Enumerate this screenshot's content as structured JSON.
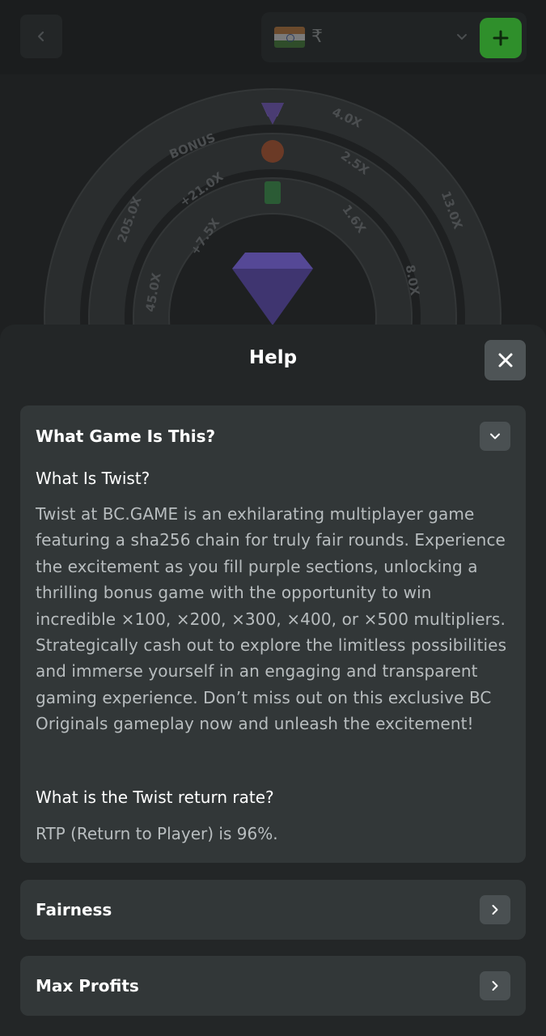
{
  "header": {
    "currency_symbol": "₹"
  },
  "game": {
    "multipliers": [
      "BONUS",
      "4.0X",
      "+21.0X",
      "2.5X",
      "+7.5X",
      "1.6X",
      "205.0X",
      "13.0X",
      "45.0X",
      "8.0X"
    ]
  },
  "help": {
    "title": "Help",
    "sections": [
      {
        "heading": "What Game Is This?",
        "question1": "What Is Twist?",
        "description": "Twist at BC.GAME is an exhilarating multiplayer game featuring a sha256 chain for truly fair rounds. Experience the excitement as you fill purple sections, unlocking a thrilling bonus game with the opportunity to win incredible ×100, ×200, ×300, ×400, or ×500 multipliers. Strategically cash out to explore the limitless possibilities and immerse yourself in an engaging and transparent gaming experience. Don’t miss out on this exclusive BC Originals gameplay now and unleash the excitement!",
        "question2": "What is the Twist return rate?",
        "answer2": "RTP (Return to Player) is 96%."
      },
      {
        "heading": "Fairness"
      },
      {
        "heading": "Max Profits"
      }
    ]
  },
  "colors": {
    "deposit": "#2f8f2b",
    "sheet_bg": "#232627",
    "section_bg": "#323738"
  }
}
